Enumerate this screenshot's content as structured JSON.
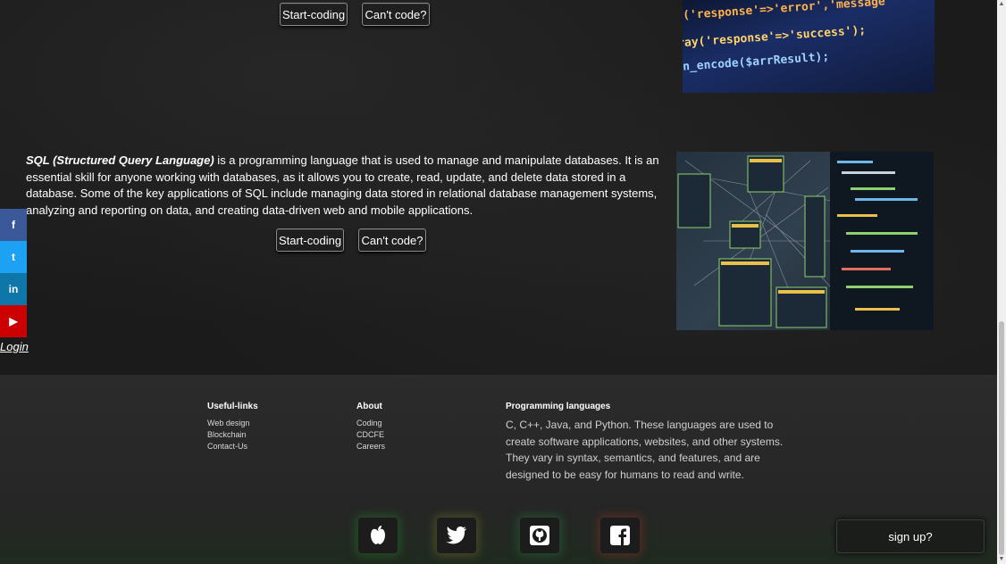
{
  "top_section": {
    "start_button": "Start-coding",
    "cant_button": "Can't code?",
    "code_lines": [
      "('response'=>'error','message'",
      "ray('response'=>'success');",
      "n_encode($arrResult);"
    ]
  },
  "sql_section": {
    "title": "SQL (Structured Query Language)",
    "body": " is a programming language that is used to manage and manipulate databases. It is an essential skill for anyone working with databases, as it allows you to create, read, update, and delete data stored in a database. Some of the key applications of SQL include managing data stored in relational database management systems, analyzing and reporting on data, and creating data-driven web and mobile applications.",
    "start_button": "Start-coding",
    "cant_button": "Can't code?"
  },
  "social_bar": {
    "items": [
      {
        "name": "facebook",
        "glyph": "f",
        "color": "#3b5998"
      },
      {
        "name": "twitter",
        "glyph": "t",
        "color": "#1da1f2"
      },
      {
        "name": "linkedin",
        "glyph": "in",
        "color": "#0e76a8"
      },
      {
        "name": "youtube",
        "glyph": "▶",
        "color": "#cc0000"
      }
    ],
    "login": "Login"
  },
  "footer": {
    "useful_links": {
      "heading": "Useful-links",
      "items": [
        "Web design",
        "Blockchain",
        "Contact-Us"
      ]
    },
    "about": {
      "heading": "About",
      "items": [
        "Coding",
        "CDCFE",
        "Careers"
      ]
    },
    "programming": {
      "heading": "Programming languages",
      "text": "C, C++, Java, and Python. These languages are used to create software applications, websites, and other systems. They vary in syntax, semantics, and features, and are designed to be easy for humans to read and write."
    },
    "icons": [
      "apple-icon",
      "twitter-icon",
      "github-icon",
      "facebook-icon"
    ],
    "signup": "sign up?"
  }
}
